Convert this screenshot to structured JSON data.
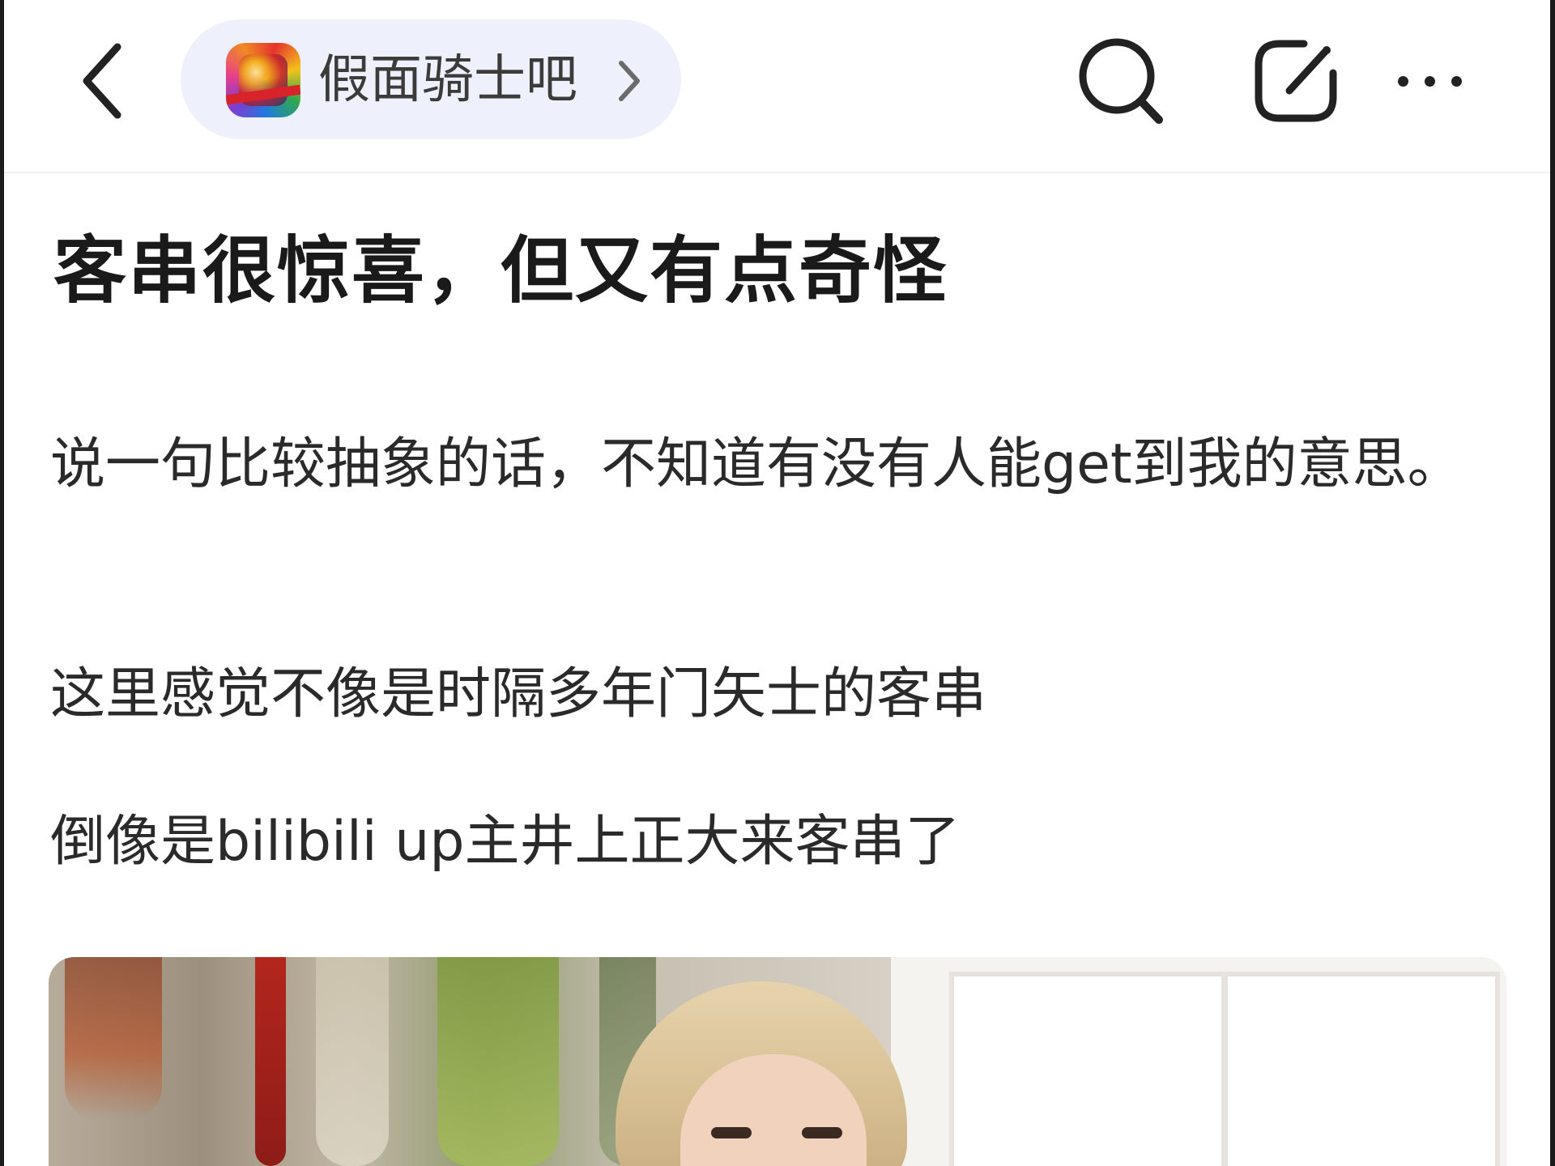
{
  "topbar": {
    "back_icon": "chevron-left-icon",
    "forum": {
      "name": "假面骑士吧",
      "avatar_icon": "forum-avatar",
      "chevron_icon": "chevron-right-icon"
    },
    "search_icon": "search-icon",
    "edit_icon": "share-edit-icon",
    "more_icon": "more-dots-icon"
  },
  "post": {
    "title": "客串很惊喜，但又有点奇怪",
    "paragraphs": [
      "说一句比较抽象的话，不知道有没有人能get到我的意思。",
      "这里感觉不像是时隔多年门矢士的客串",
      "倒像是bilibili up主井上正大来客串了"
    ],
    "image": "post-photo"
  },
  "colors": {
    "pill_background": "#eef0fb",
    "text_primary": "#1a1a1a",
    "icon": "#222222"
  }
}
